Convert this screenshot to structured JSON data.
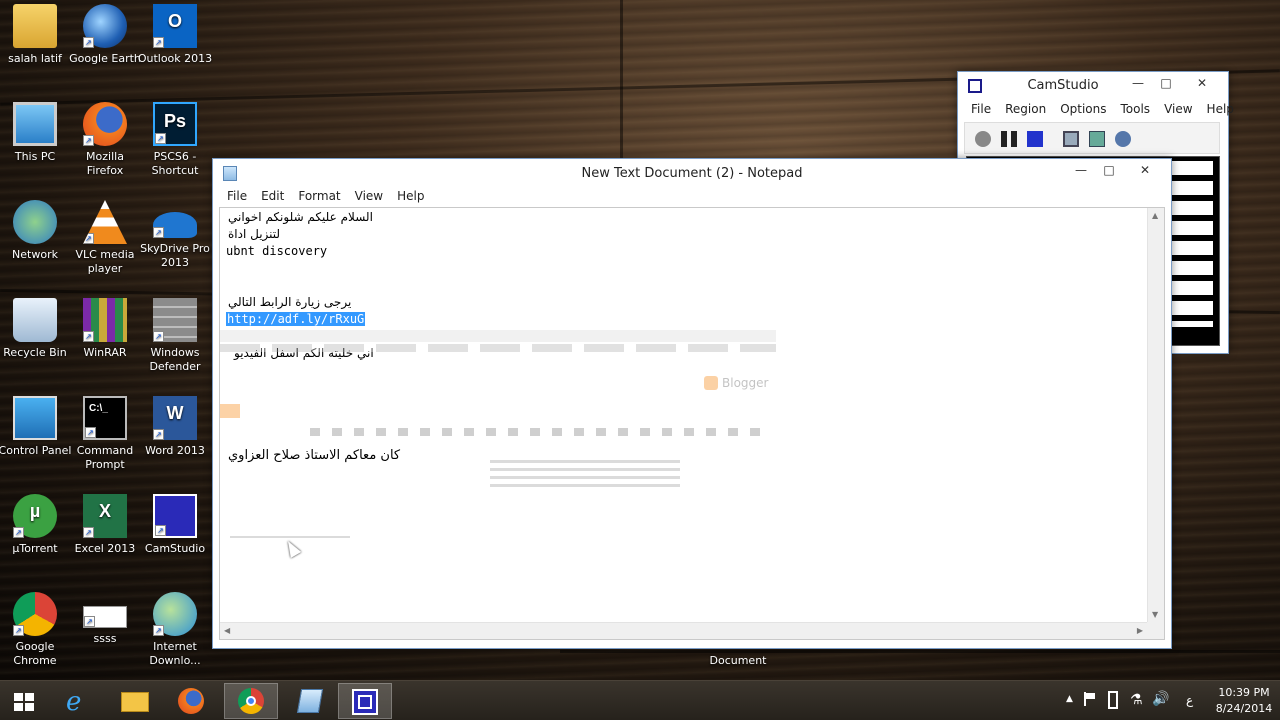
{
  "desktop": {
    "icons": [
      {
        "label": "salah latif",
        "icon": "folder-user-icon"
      },
      {
        "label": "Google Earth",
        "icon": "google-earth-icon"
      },
      {
        "label": "Outlook 2013",
        "icon": "outlook-icon"
      },
      {
        "label": "This PC",
        "icon": "computer-icon"
      },
      {
        "label": "Mozilla Firefox",
        "icon": "firefox-icon"
      },
      {
        "label": "PSCS6 - Shortcut",
        "icon": "photoshop-icon"
      },
      {
        "label": "Network",
        "icon": "network-icon"
      },
      {
        "label": "VLC media player",
        "icon": "vlc-icon"
      },
      {
        "label": "SkyDrive Pro 2013",
        "icon": "skydrive-icon"
      },
      {
        "label": "Recycle Bin",
        "icon": "recycle-bin-icon"
      },
      {
        "label": "WinRAR",
        "icon": "winrar-icon"
      },
      {
        "label": "Windows Defender",
        "icon": "windows-defender-icon"
      },
      {
        "label": "Control Panel",
        "icon": "control-panel-icon"
      },
      {
        "label": "Command Prompt",
        "icon": "command-prompt-icon"
      },
      {
        "label": "Word 2013",
        "icon": "word-icon"
      },
      {
        "label": "µTorrent",
        "icon": "utorrent-icon"
      },
      {
        "label": "Excel 2013",
        "icon": "excel-icon"
      },
      {
        "label": "CamStudio",
        "icon": "camstudio-icon"
      },
      {
        "label": "Google Chrome",
        "icon": "chrome-icon"
      },
      {
        "label": "ssss",
        "icon": "ssss-icon"
      },
      {
        "label": "Internet Downlo...",
        "icon": "internet-download-manager-icon"
      }
    ],
    "document_label": "Document"
  },
  "camstudio": {
    "title": "CamStudio",
    "menu": [
      "File",
      "Region",
      "Options",
      "Tools",
      "View",
      "Help"
    ]
  },
  "notepad": {
    "title": "New Text Document (2) - Notepad",
    "menu": [
      "File",
      "Edit",
      "Format",
      "View",
      "Help"
    ],
    "lines": {
      "l1": "السلام عليكم شلونكم اخواني",
      "l2": "لتنزيل  اداة",
      "l3": "ubnt discovery",
      "l4": "يرجى زيارة الرابط التالي",
      "l5": "http://adf.ly/rRxuG",
      "l6": "اني خليته الكم اسفل الفيديو",
      "l7": "كان معاكم الاستاذ صلاح العزاوي"
    }
  },
  "ghost_browser": {
    "brand": "Blogger"
  },
  "taskbar": {
    "items": [
      {
        "name": "start-button",
        "icon": "windows-logo-icon"
      },
      {
        "name": "taskbar-ie",
        "icon": "internet-explorer-icon"
      },
      {
        "name": "taskbar-explorer",
        "icon": "file-explorer-icon"
      },
      {
        "name": "taskbar-firefox",
        "icon": "firefox-icon"
      },
      {
        "name": "taskbar-chrome",
        "icon": "chrome-icon"
      },
      {
        "name": "taskbar-notepad",
        "icon": "notepad-icon"
      },
      {
        "name": "taskbar-camstudio",
        "icon": "camstudio-icon"
      }
    ],
    "tray": {
      "language": "ع",
      "time": "10:39 PM",
      "date": "8/24/2014"
    }
  }
}
